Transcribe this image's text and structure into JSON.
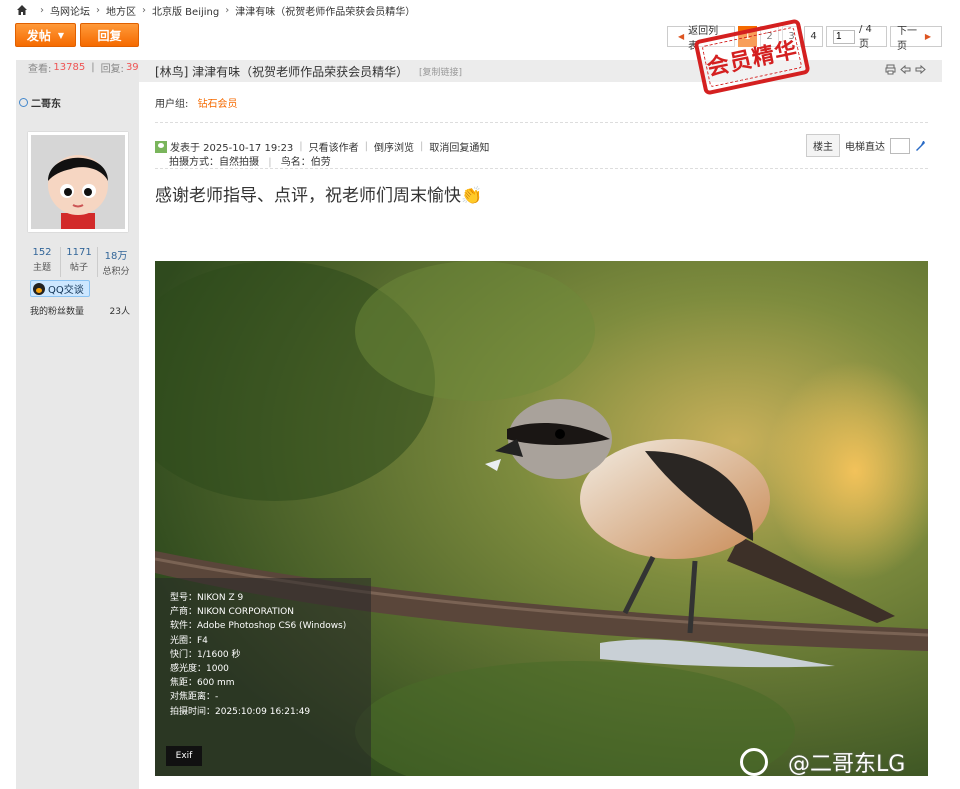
{
  "breadcrumb": [
    "鸟网论坛",
    "地方区",
    "北京版 Beijing",
    "津津有味（祝贺老师作品荣获会员精华）"
  ],
  "toolbar": {
    "post_label": "发帖",
    "reply_label": "回复"
  },
  "pager": {
    "back_label": "返回列表",
    "pages": [
      "1",
      "2",
      "3",
      "4"
    ],
    "current": "1",
    "input_value": "1",
    "total_label": "/ 4 页",
    "next_label": "下一页"
  },
  "stamp_text": "会员精华",
  "sidebar": {
    "views_label": "查看:",
    "views": "13785",
    "replies_label": "回复:",
    "replies": "39",
    "username": "二哥东",
    "counts": [
      {
        "num": "152",
        "label": "主题"
      },
      {
        "num": "1171",
        "label": "帖子"
      },
      {
        "num": "18万",
        "label": "总积分"
      }
    ],
    "qq_label": "QQ交谈",
    "fans_label": "我的粉丝数量",
    "fans_value": "23人"
  },
  "post": {
    "title": "[林鸟] 津津有味（祝贺老师作品荣获会员精华）",
    "copy_link": "[复制链接]",
    "usergroup_label": "用户组:",
    "usergroup_value": "钻石会员",
    "posted_at": "发表于 2025-10-17 19:23",
    "only_author": "只看该作者",
    "reverse": "倒序浏览",
    "cancel_notify": "取消回复通知",
    "shoot_method": "拍摄方式：自然拍摄",
    "bird_name": "鸟名：伯劳",
    "floor_label": "楼主",
    "elevator_label": "电梯直达",
    "headline": "感谢老师指导、点评，祝老师们周末愉快👏"
  },
  "exif": {
    "lines": [
      "型号：NIKON Z 9",
      "产商：NIKON CORPORATION",
      "软件：Adobe Photoshop CS6 (Windows)",
      "光圈：F4",
      "快门：1/1600 秒",
      "感光度：1000",
      "焦距：600 mm",
      "对焦距离：-",
      "拍摄时间：2025:10:09 16:21:49"
    ],
    "button_label": "Exif"
  },
  "watermark": "@二哥东LG",
  "colors": {
    "accent": "#f56a00",
    "link": "#336699",
    "stamp": "#d42020"
  }
}
